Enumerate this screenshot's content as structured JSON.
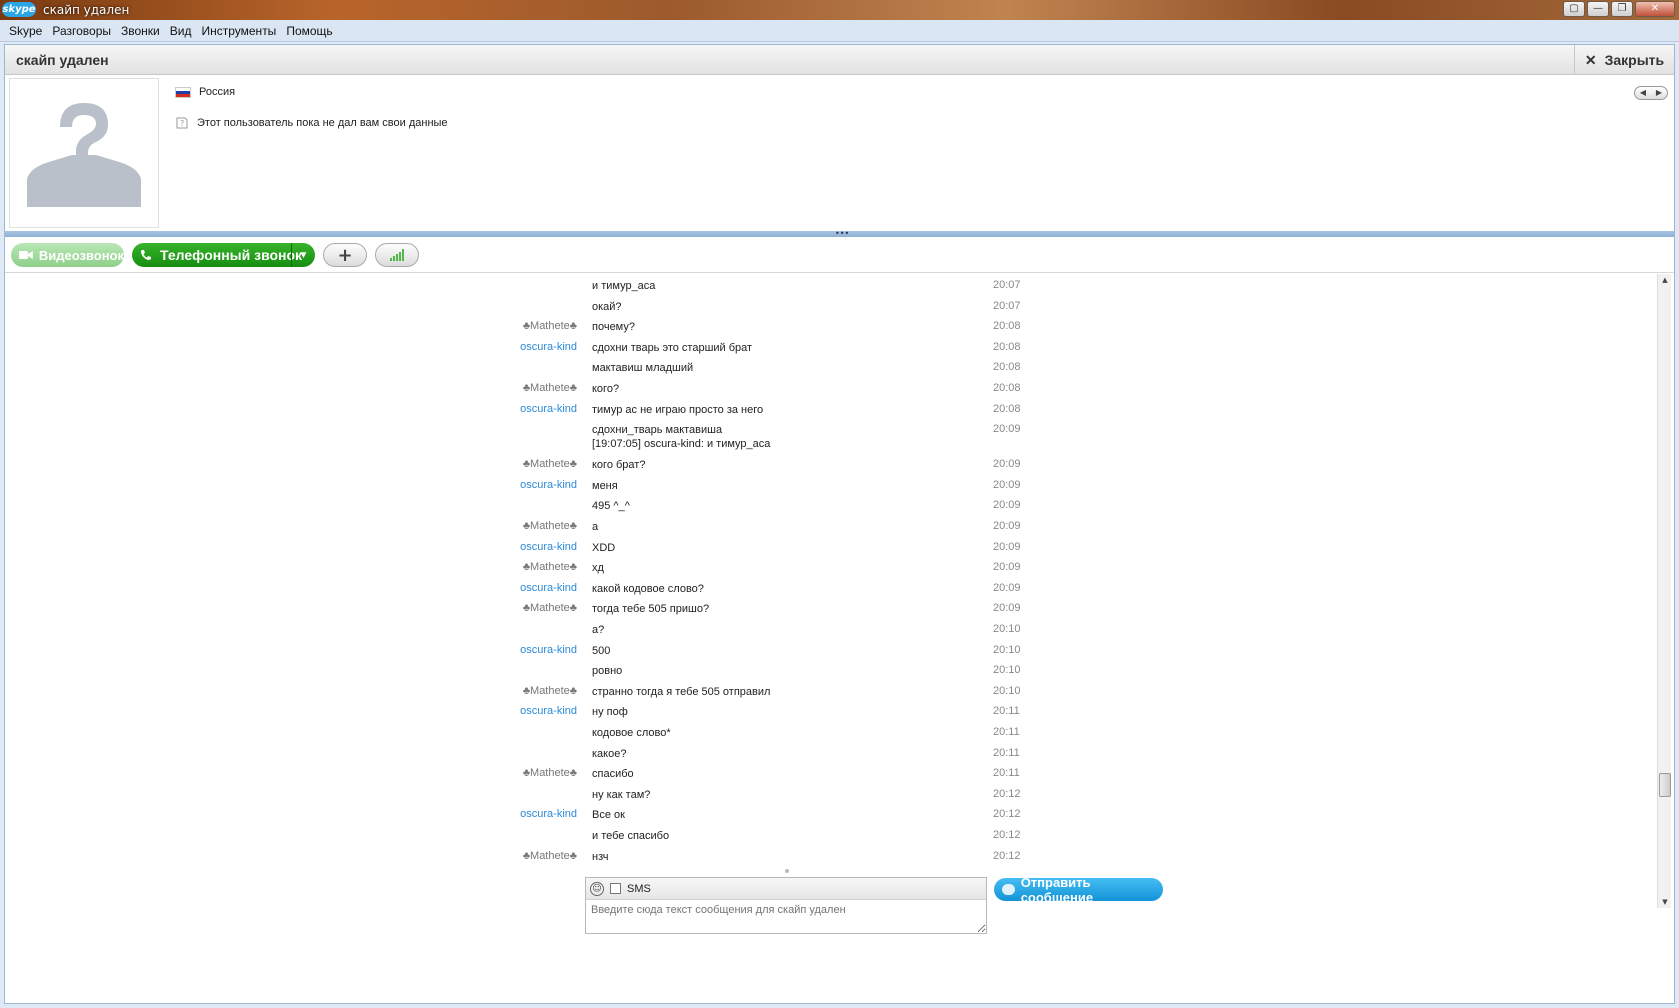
{
  "window": {
    "logo_text": "skype",
    "title": "скайп удален",
    "controls": [
      "▢",
      "—",
      "❐",
      "✕"
    ]
  },
  "menu": [
    "Skype",
    "Разговоры",
    "Звонки",
    "Вид",
    "Инструменты",
    "Помощь"
  ],
  "header": {
    "contact_name": "скайп удален",
    "close_label": "Закрыть"
  },
  "profile": {
    "country": "Россия",
    "note": "Этот пользователь пока не дал вам свои данные"
  },
  "toolbar": {
    "video_call": "Видеозвонок",
    "phone_call": "Телефонный звонок"
  },
  "messages": [
    {
      "author": "",
      "text": "и тимур_аса",
      "time": "20:07"
    },
    {
      "author": "",
      "text": "окай?",
      "time": "20:07"
    },
    {
      "author": "♣Mathete♣",
      "type": "mathete",
      "text": "почему?",
      "time": "20:08"
    },
    {
      "author": "oscura-kind",
      "type": "oscura",
      "text": "сдохни тварь это старший брат",
      "time": "20:08"
    },
    {
      "author": "",
      "text": "мактавиш младший",
      "time": "20:08"
    },
    {
      "author": "♣Mathete♣",
      "type": "mathete",
      "text": "кого?",
      "time": "20:08"
    },
    {
      "author": "oscura-kind",
      "type": "oscura",
      "text": "тимур ас не играю просто за него",
      "time": "20:08"
    },
    {
      "author": "",
      "text": "сдохни_тварь мактавиша\n[19:07:05] oscura-kind: и тимур_аса",
      "time": "20:09",
      "double": true
    },
    {
      "author": "♣Mathete♣",
      "type": "mathete",
      "text": "кого брат?",
      "time": "20:09"
    },
    {
      "author": "oscura-kind",
      "type": "oscura",
      "text": "меня",
      "time": "20:09"
    },
    {
      "author": "",
      "text": "495 ^_^",
      "time": "20:09"
    },
    {
      "author": "♣Mathete♣",
      "type": "mathete",
      "text": "а",
      "time": "20:09"
    },
    {
      "author": "oscura-kind",
      "type": "oscura",
      "text": "XDD",
      "time": "20:09"
    },
    {
      "author": "♣Mathete♣",
      "type": "mathete",
      "text": "хд",
      "time": "20:09"
    },
    {
      "author": "oscura-kind",
      "type": "oscura",
      "text": "какой кодовое слово?",
      "time": "20:09"
    },
    {
      "author": "♣Mathete♣",
      "type": "mathete",
      "text": "тогда тебе 505 пришо?",
      "time": "20:09"
    },
    {
      "author": "",
      "text": "а?",
      "time": "20:10"
    },
    {
      "author": "oscura-kind",
      "type": "oscura",
      "text": "500",
      "time": "20:10"
    },
    {
      "author": "",
      "text": "ровно",
      "time": "20:10"
    },
    {
      "author": "♣Mathete♣",
      "type": "mathete",
      "text": "странно тогда я тебе 505 отправил",
      "time": "20:10"
    },
    {
      "author": "oscura-kind",
      "type": "oscura",
      "text": "ну поф",
      "time": "20:11"
    },
    {
      "author": "",
      "text": "кодовое слово*",
      "time": "20:11"
    },
    {
      "author": "",
      "text": "какое?",
      "time": "20:11"
    },
    {
      "author": "♣Mathete♣",
      "type": "mathete",
      "text": "спасибо",
      "time": "20:11"
    },
    {
      "author": "",
      "text": "ну как там?",
      "time": "20:12"
    },
    {
      "author": "oscura-kind",
      "type": "oscura",
      "text": "Все ок",
      "time": "20:12"
    },
    {
      "author": "",
      "text": "и тебе спасибо",
      "time": "20:12"
    },
    {
      "author": "♣Mathete♣",
      "type": "mathete",
      "text": "нзч",
      "time": "20:12"
    }
  ],
  "input": {
    "sms_label": "SMS",
    "placeholder": "Введите сюда текст сообщения для скайп удален",
    "send_label": "Отправить сообщение"
  },
  "colors": {
    "author_oscura": "#2b8ad8",
    "author_mathete": "#777777",
    "send_button": "#1393d6",
    "call_button": "#168d10"
  },
  "icons": {
    "flag": "russia-flag-icon",
    "note": "info-icon",
    "emoji": "smiley-icon"
  }
}
